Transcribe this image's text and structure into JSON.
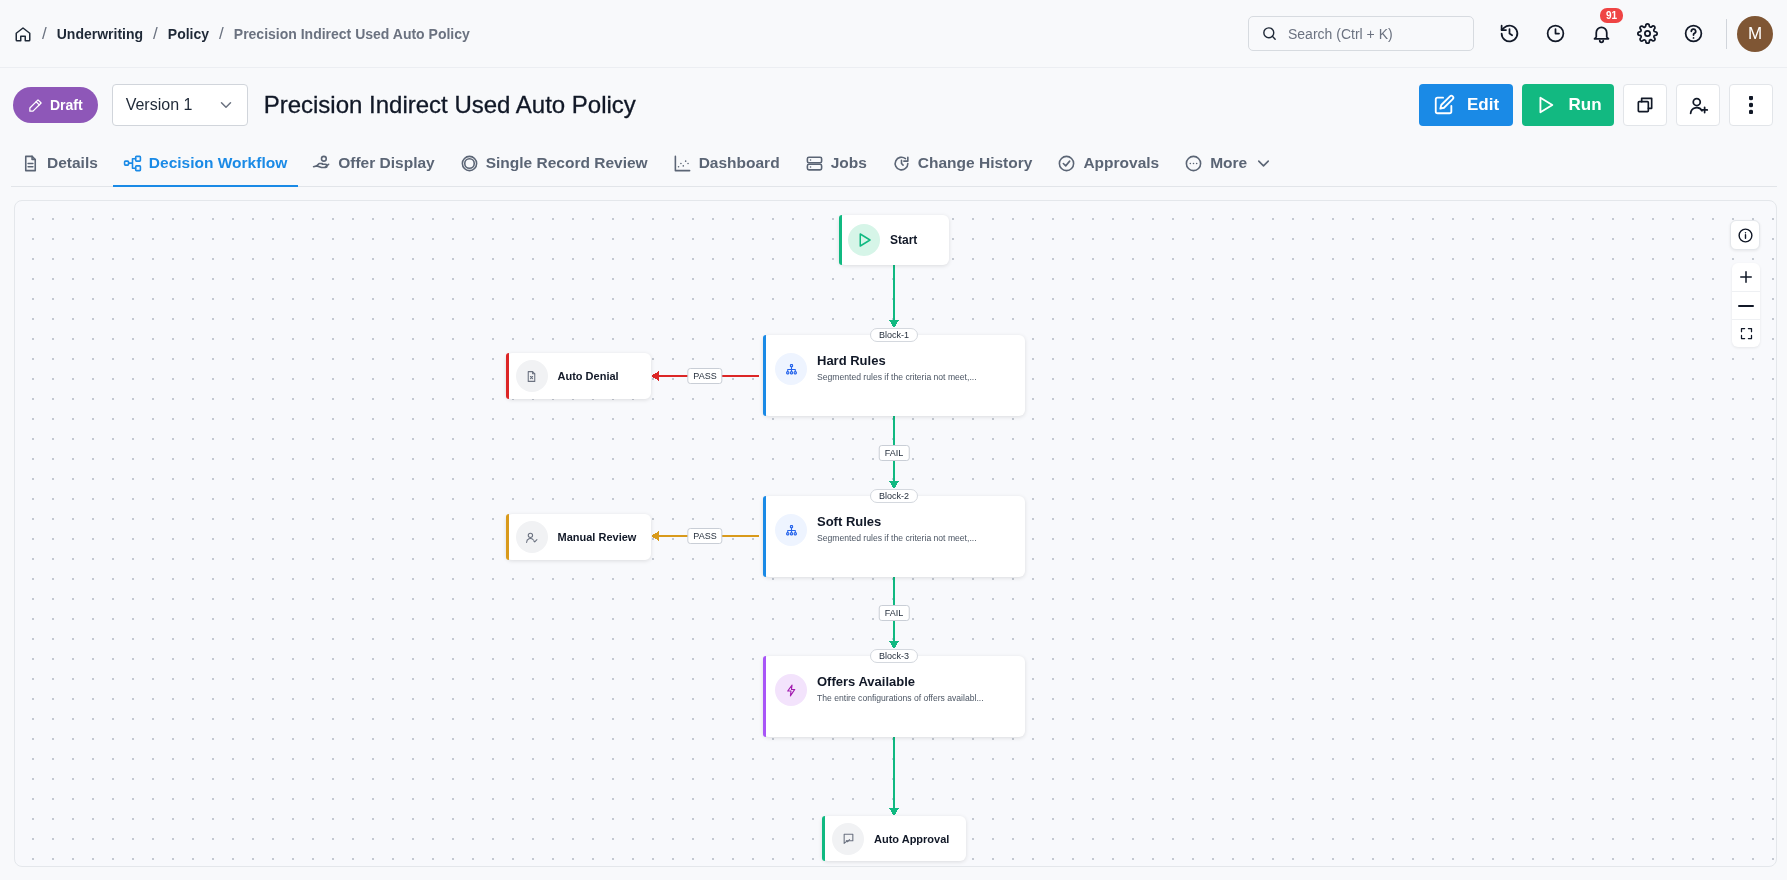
{
  "breadcrumbs": {
    "separator": "/",
    "items": [
      {
        "label": "Underwriting",
        "current": false
      },
      {
        "label": "Policy",
        "current": false
      },
      {
        "label": "Precision Indirect Used Auto Policy",
        "current": true
      }
    ]
  },
  "search": {
    "placeholder": "Search (Ctrl + K)"
  },
  "notifications": {
    "count": "91"
  },
  "avatar": {
    "initial": "M"
  },
  "policy": {
    "status": "Draft",
    "version": "Version 1",
    "title": "Precision Indirect Used Auto Policy"
  },
  "actions": [
    {
      "kind": "edit",
      "label": "Edit"
    },
    {
      "kind": "run",
      "label": "Run"
    },
    {
      "kind": "copy"
    },
    {
      "kind": "add-user"
    },
    {
      "kind": "more"
    }
  ],
  "tabs": [
    {
      "label": "Details",
      "selected": false
    },
    {
      "label": "Decision Workflow",
      "selected": true
    },
    {
      "label": "Offer Display",
      "selected": false
    },
    {
      "label": "Single Record Review",
      "selected": false
    },
    {
      "label": "Dashboard",
      "selected": false
    },
    {
      "label": "Jobs",
      "selected": false
    },
    {
      "label": "Change History",
      "selected": false
    },
    {
      "label": "Approvals",
      "selected": false
    },
    {
      "label": "More",
      "selected": false
    }
  ],
  "workflow": {
    "nodes": [
      {
        "kind": "start",
        "title": "Start",
        "color": "#10b981"
      },
      {
        "kind": "denial",
        "title": "Auto Denial",
        "color": "#dc2626"
      },
      {
        "kind": "rules",
        "block": "Block-1",
        "title": "Hard Rules",
        "description": "Segmented rules if the criteria not meet,...",
        "color": "#1a8ae6"
      },
      {
        "kind": "review",
        "title": "Manual Review",
        "color": "#d99a1b"
      },
      {
        "kind": "rules",
        "block": "Block-2",
        "title": "Soft Rules",
        "description": "Segmented rules if the criteria not meet,...",
        "color": "#1a8ae6"
      },
      {
        "kind": "offers",
        "block": "Block-3",
        "title": "Offers Available",
        "description": "The entire configurations of offers availabl...",
        "color": "#a855f7"
      },
      {
        "kind": "approval",
        "title": "Auto Approval",
        "color": "#10b981"
      }
    ],
    "edges": [
      {
        "color": "#10b981"
      },
      {
        "label": "PASS",
        "color": "#dc2626"
      },
      {
        "label": "FAIL",
        "color": "#10b981"
      },
      {
        "label": "PASS",
        "color": "#d99a1b"
      },
      {
        "label": "FAIL",
        "color": "#10b981"
      },
      {
        "color": "#10b981"
      }
    ]
  }
}
